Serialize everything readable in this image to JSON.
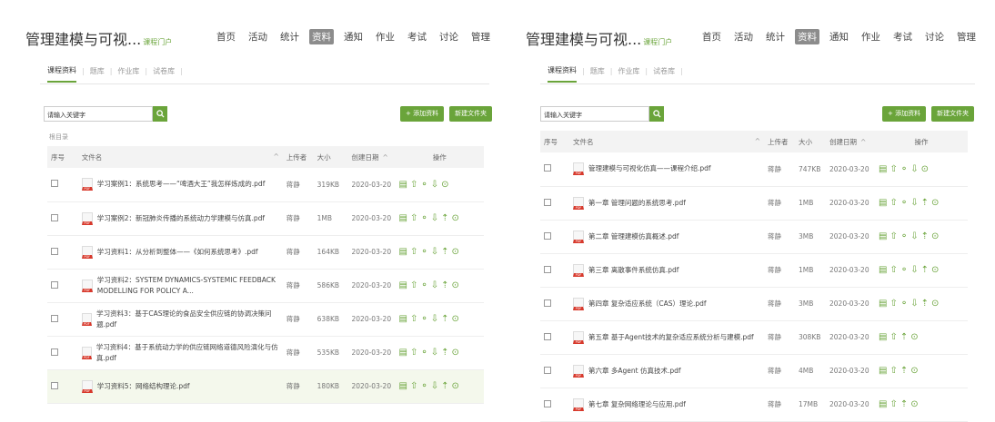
{
  "colors": {
    "accent": "#6aa43a",
    "pdf_red": "#d8382b"
  },
  "left": {
    "brand": {
      "title": "管理建模与可视...",
      "sub": "课程门户"
    },
    "nav": [
      "首页",
      "活动",
      "统计",
      "资料",
      "通知",
      "作业",
      "考试",
      "讨论",
      "管理"
    ],
    "nav_active": "资料",
    "subtabs": [
      "课程资料",
      "题库",
      "作业库",
      "试卷库"
    ],
    "search_placeholder": "请输入关键字",
    "actions": {
      "upload": "+ 添加资料",
      "new_folder": "新建文件夹"
    },
    "root_dir": "根目录",
    "headers": {
      "index": "序号",
      "name": "文件名",
      "uploader": "上传者",
      "size": "大小",
      "date": "创建日期",
      "ops": "操作"
    },
    "rows": [
      {
        "name": "学习案例1：系统思考——“啤酒大王”我怎样炼成的.pdf",
        "uploader": "蒋静",
        "size": "319KB",
        "date": "2020-03-20"
      },
      {
        "name": "学习案例2：新冠肺炎传播的系统动力学建模与仿真.pdf",
        "uploader": "蒋静",
        "size": "1MB",
        "date": "2020-03-20"
      },
      {
        "name": "学习资料1：从分析到整体——《如何系统思考》.pdf",
        "uploader": "蒋静",
        "size": "164KB",
        "date": "2020-03-20"
      },
      {
        "name": "学习资料2：SYSTEM DYNAMICS-SYSTEMIC FEEDBACK MODELLING FOR POLICY A...",
        "uploader": "蒋静",
        "size": "586KB",
        "date": "2020-03-20"
      },
      {
        "name": "学习资料3：基于CAS理论的食品安全供应链的协调决策问题.pdf",
        "uploader": "蒋静",
        "size": "638KB",
        "date": "2020-03-20"
      },
      {
        "name": "学习资料4：基于系统动力学的供应链网络道德风险演化与仿真.pdf",
        "uploader": "蒋静",
        "size": "535KB",
        "date": "2020-03-20"
      },
      {
        "name": "学习资料5：网络结构理论.pdf",
        "uploader": "蒋静",
        "size": "180KB",
        "date": "2020-03-20"
      }
    ]
  },
  "right": {
    "brand": {
      "title": "管理建模与可视...",
      "sub": "课程门户"
    },
    "nav": [
      "首页",
      "活动",
      "统计",
      "资料",
      "通知",
      "作业",
      "考试",
      "讨论",
      "管理"
    ],
    "nav_active": "资料",
    "subtabs": [
      "课程资料",
      "题库",
      "作业库",
      "试卷库"
    ],
    "search_placeholder": "请输入关键字",
    "actions": {
      "upload": "+ 添加资料",
      "new_folder": "新建文件夹"
    },
    "headers": {
      "index": "序号",
      "name": "文件名",
      "uploader": "上传者",
      "size": "大小",
      "date": "创建日期",
      "ops": "操作"
    },
    "rows": [
      {
        "name": "管理建模与可视化仿真——课程介绍.pdf",
        "uploader": "蒋静",
        "size": "747KB",
        "date": "2020-03-20"
      },
      {
        "name": "第一章 管理问题的系统思考.pdf",
        "uploader": "蒋静",
        "size": "1MB",
        "date": "2020-03-20"
      },
      {
        "name": "第二章 管理建模仿真概述.pdf",
        "uploader": "蒋静",
        "size": "3MB",
        "date": "2020-03-20"
      },
      {
        "name": "第三章 离散事件系统仿真.pdf",
        "uploader": "蒋静",
        "size": "1MB",
        "date": "2020-03-20"
      },
      {
        "name": "第四章 复杂适应系统（CAS）理论.pdf",
        "uploader": "蒋静",
        "size": "3MB",
        "date": "2020-03-20"
      },
      {
        "name": "第五章 基于Agent技术的复杂适应系统分析与建模.pdf",
        "uploader": "蒋静",
        "size": "308KB",
        "date": "2020-03-20"
      },
      {
        "name": "第六章 多Agent 仿真技术.pdf",
        "uploader": "蒋静",
        "size": "4MB",
        "date": "2020-03-20"
      },
      {
        "name": "第七章 复杂网络理论与应用.pdf",
        "uploader": "蒋静",
        "size": "17MB",
        "date": "2020-03-20"
      }
    ]
  }
}
